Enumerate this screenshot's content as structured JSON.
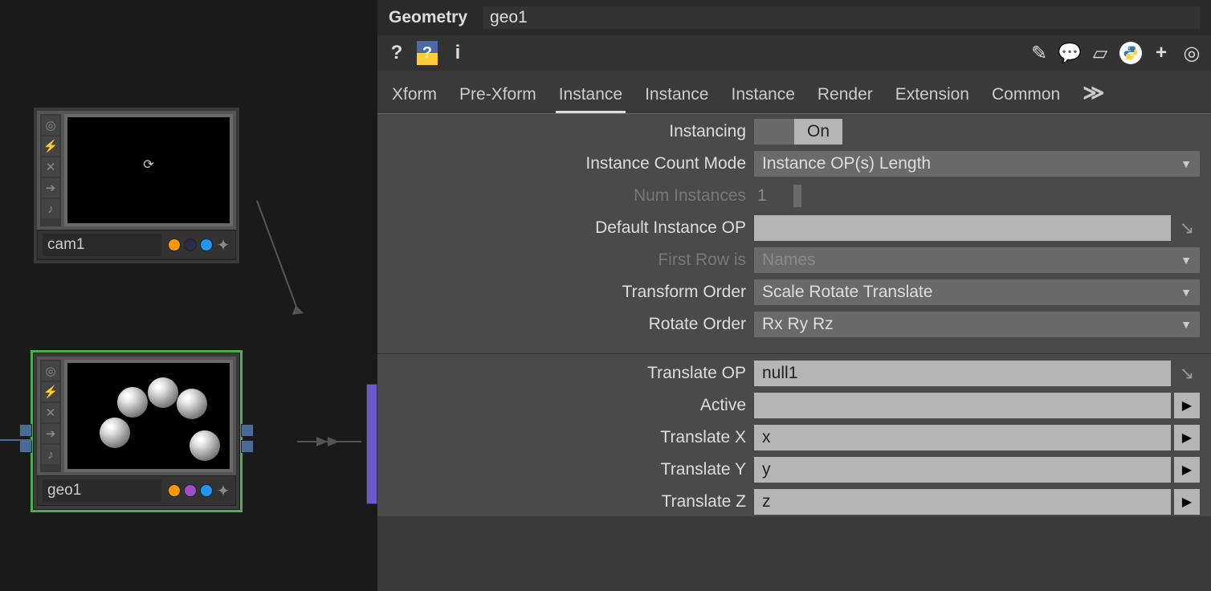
{
  "header": {
    "type_label": "Geometry",
    "op_name": "geo1"
  },
  "tabs": [
    "Xform",
    "Pre-Xform",
    "Instance",
    "Instance",
    "Instance",
    "Render",
    "Extension",
    "Common"
  ],
  "active_tab_index": 2,
  "params": {
    "instancing": {
      "label": "Instancing",
      "value": "On",
      "off_label": ""
    },
    "instance_count_mode": {
      "label": "Instance Count Mode",
      "value": "Instance OP(s) Length"
    },
    "num_instances": {
      "label": "Num Instances",
      "value": "1"
    },
    "default_instance_op": {
      "label": "Default Instance OP",
      "value": ""
    },
    "first_row_is": {
      "label": "First Row is",
      "value": "Names"
    },
    "transform_order": {
      "label": "Transform Order",
      "value": "Scale Rotate Translate"
    },
    "rotate_order": {
      "label": "Rotate Order",
      "value": "Rx Ry Rz"
    },
    "translate_op": {
      "label": "Translate OP",
      "value": "null1"
    },
    "active": {
      "label": "Active",
      "value": ""
    },
    "translate_x": {
      "label": "Translate X",
      "value": "x"
    },
    "translate_y": {
      "label": "Translate Y",
      "value": "y"
    },
    "translate_z": {
      "label": "Translate Z",
      "value": "z"
    }
  },
  "nodes": {
    "cam1": {
      "name": "cam1"
    },
    "geo1": {
      "name": "geo1"
    }
  }
}
